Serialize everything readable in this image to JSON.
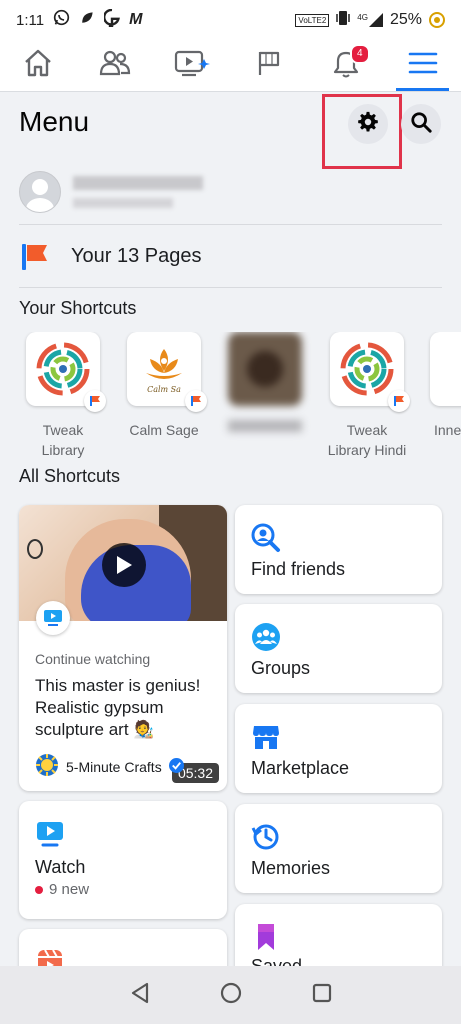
{
  "status_bar": {
    "time": "1:11",
    "network_label": "4G",
    "lte_label": "VoLTE2",
    "battery": "25%",
    "icons": [
      "whatsapp-icon",
      "app-leaf-icon",
      "app-g-icon",
      "app-m-icon",
      "vibrate-icon",
      "signal-icon",
      "battery-saver-icon"
    ]
  },
  "nav_tabs": [
    {
      "name": "home",
      "icon": "home-icon"
    },
    {
      "name": "friends",
      "icon": "friends-icon"
    },
    {
      "name": "watch",
      "icon": "video-icon"
    },
    {
      "name": "pages",
      "icon": "flag-icon"
    },
    {
      "name": "notifications",
      "icon": "bell-icon",
      "badge": "4"
    },
    {
      "name": "menu",
      "icon": "hamburger-icon",
      "active": true
    }
  ],
  "header": {
    "title": "Menu",
    "settings_icon": "gear-icon",
    "search_icon": "search-icon"
  },
  "pages": {
    "label": "Your 13 Pages"
  },
  "shortcuts": {
    "title": "Your Shortcuts",
    "items": [
      {
        "label_line1": "Tweak",
        "label_line2": "Library"
      },
      {
        "label_line1": "Calm Sage",
        "label_line2": "",
        "logo_text": "Calm Sa"
      },
      {
        "label_line1": "",
        "label_line2": ""
      },
      {
        "label_line1": "Tweak",
        "label_line2": "Library Hindi"
      },
      {
        "label_line1": "Inne",
        "label_line2": ""
      }
    ]
  },
  "all_shortcuts": {
    "title": "All Shortcuts",
    "video_card": {
      "duration": "05:32",
      "section_label": "Continue watching",
      "title": "This master is genius! Realistic gypsum sculpture art 🧑‍🎨",
      "channel": "5-Minute Crafts"
    },
    "watch": {
      "label": "Watch",
      "new_count": "9 new"
    },
    "right_cards": [
      {
        "label": "Find friends",
        "icon": "find-friends-icon"
      },
      {
        "label": "Groups",
        "icon": "groups-icon"
      },
      {
        "label": "Marketplace",
        "icon": "marketplace-icon"
      },
      {
        "label": "Memories",
        "icon": "memories-icon"
      },
      {
        "label": "Saved",
        "icon": "saved-icon"
      }
    ]
  },
  "colors": {
    "accent": "#1877f2",
    "background": "#f0f2f5",
    "badge_red": "#e41e3f",
    "highlight_red": "#e0334a"
  }
}
